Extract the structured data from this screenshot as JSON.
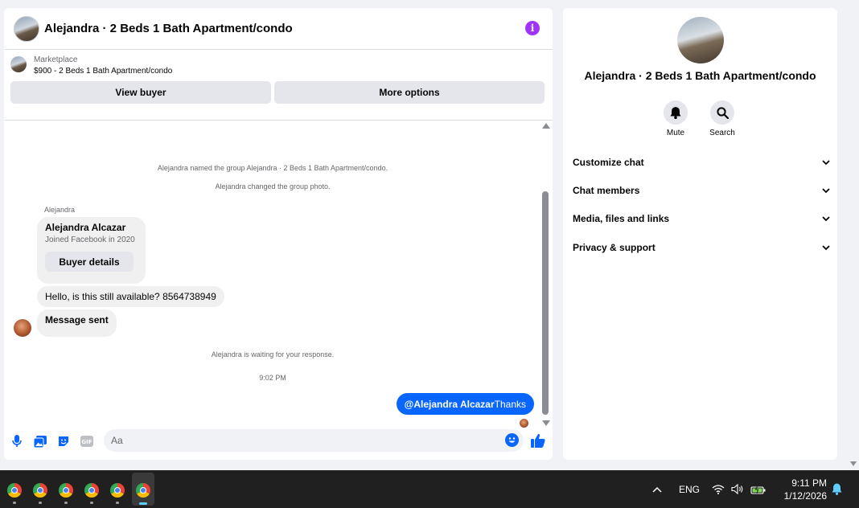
{
  "chat": {
    "title": "Alejandra · 2 Beds 1 Bath Apartment/condo",
    "marketplace_label": "Marketplace",
    "listing": "$900 - 2 Beds 1 Bath Apartment/condo",
    "view_buyer": "View buyer",
    "more_options": "More options",
    "system_messages": [
      "Alejandra named the group Alejandra · 2 Beds 1 Bath Apartment/condo.",
      "Alejandra changed the group photo."
    ],
    "sender_name": "Alejandra",
    "card": {
      "name": "Alejandra Alcazar",
      "joined": "Joined Facebook in 2020",
      "button": "Buyer details"
    },
    "incoming": [
      "Hello, is this still available? 8564738949",
      "Message sent"
    ],
    "waiting": "Alejandra is waiting for your response.",
    "timestamp": "9:02 PM",
    "outgoing": {
      "mention": "@Alejandra Alcazar",
      "text": "Thanks"
    },
    "composer_placeholder": "Aa"
  },
  "details": {
    "title": "Alejandra · 2 Beds 1 Bath Apartment/condo",
    "actions": [
      "Mute",
      "Search"
    ],
    "sections": [
      "Customize chat",
      "Chat members",
      "Media, files and links",
      "Privacy & support"
    ]
  },
  "taskbar": {
    "language": "ENG",
    "time": "9:11 PM",
    "date": "1/12/2026"
  },
  "colors": {
    "accent": "#0866ff",
    "info": "#a033ff"
  }
}
